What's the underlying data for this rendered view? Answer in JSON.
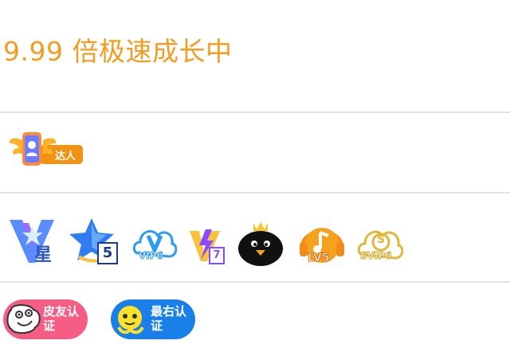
{
  "speed": {
    "text": "9.99 倍极速成长中"
  },
  "talent": {
    "label": "达人"
  },
  "vip_icons": {
    "star_vip": {
      "mark": "星"
    },
    "super_vip": {
      "mark": "5"
    },
    "vip": {
      "text": "VIP6"
    },
    "flash": {
      "mark": "7"
    },
    "music": {
      "text": "LV5"
    },
    "svip": {
      "text": "SVIP6"
    }
  },
  "auth": {
    "pi_you": {
      "label": "皮友认证"
    },
    "zui_you": {
      "label": "最右认证"
    }
  },
  "colors": {
    "speed_text": "#f39c1f",
    "divider": "#e2e2e2",
    "pi_you_bg": "#f55d84",
    "zui_you_bg": "#1a7fe8"
  }
}
